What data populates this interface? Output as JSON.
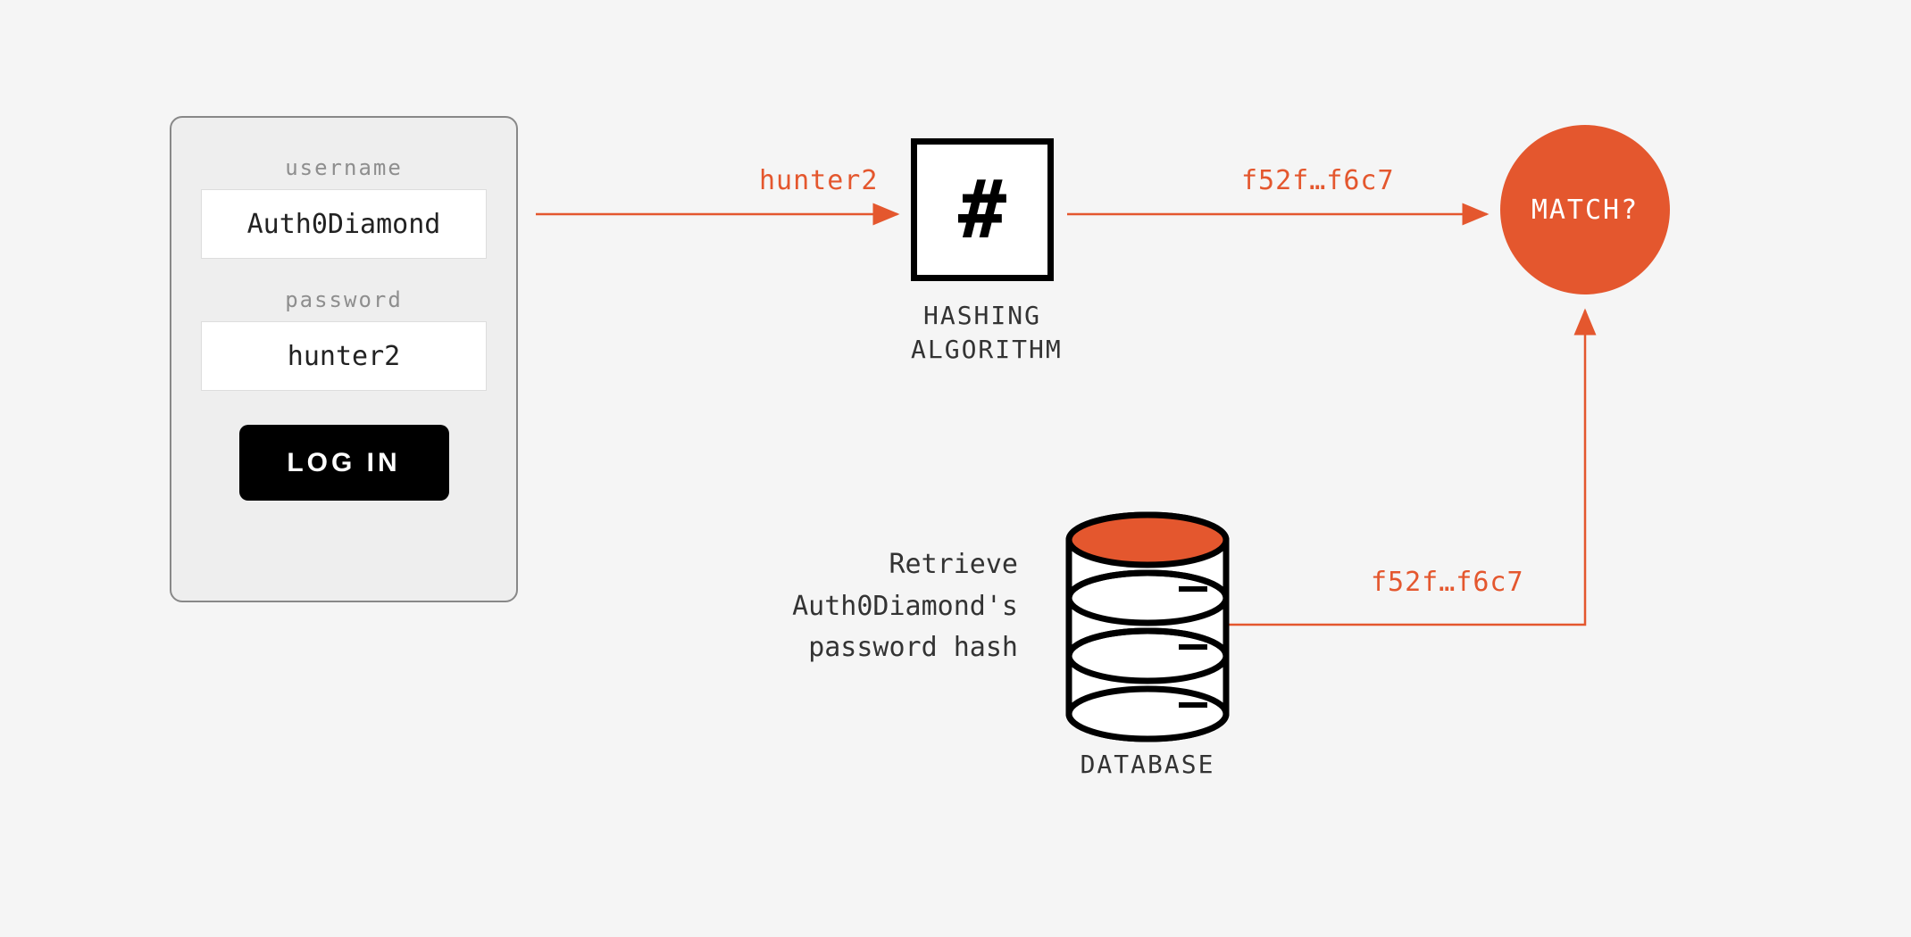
{
  "login": {
    "username_label": "username",
    "username_value": "Auth0Diamond",
    "password_label": "password",
    "password_value": "hunter2",
    "button_label": "LOG IN"
  },
  "arrows": {
    "password_plain": "hunter2",
    "hash_output": "f52f…f6c7",
    "db_hash": "f52f…f6c7"
  },
  "hash_box": {
    "symbol": "#",
    "label_line1": "HASHING",
    "label_line2": "ALGORITHM"
  },
  "match": {
    "label": "MATCH?"
  },
  "database": {
    "retrieve_line1": "Retrieve",
    "retrieve_line2": "Auth0Diamond's",
    "retrieve_line3": "password hash",
    "label": "DATABASE"
  },
  "colors": {
    "accent": "#e4572e"
  }
}
